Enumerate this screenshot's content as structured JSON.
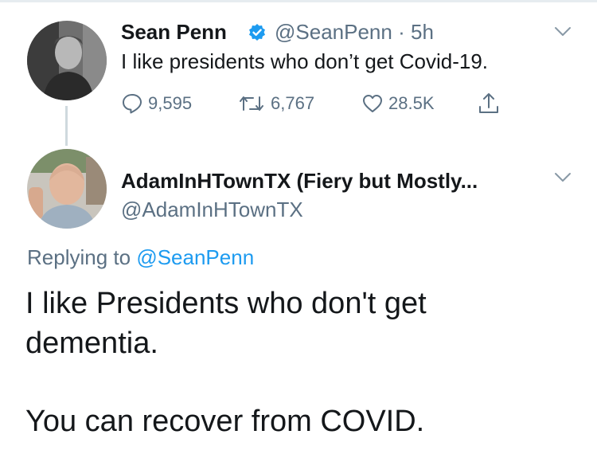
{
  "tweet": {
    "author_name": "Sean Penn",
    "handle": "@SeanPenn",
    "separator": "·",
    "time": "5h",
    "text": "I like presidents who don’t get Covid-19.",
    "replies": "9,595",
    "retweets": "6,767",
    "likes": "28.5K",
    "verified": true
  },
  "reply": {
    "author_name": "AdamInHTownTX (Fiery but Mostly...",
    "handle": "@AdamInHTownTX",
    "replying_prefix": "Replying to",
    "replying_handle": "@SeanPenn",
    "text_line1": "I like Presidents who don't get",
    "text_line2": "dementia.",
    "text_paragraph2": "You can recover from COVID."
  },
  "icons": {
    "verified": "verified-badge-icon",
    "chevron": "chevron-down-icon",
    "reply": "reply-icon",
    "retweet": "retweet-icon",
    "like": "heart-icon",
    "share": "share-icon"
  },
  "colors": {
    "text": "#14171a",
    "secondary": "#5b7083",
    "link": "#1d9bf0",
    "verified": "#1d9bf0",
    "thread_line": "#cfd9de"
  }
}
